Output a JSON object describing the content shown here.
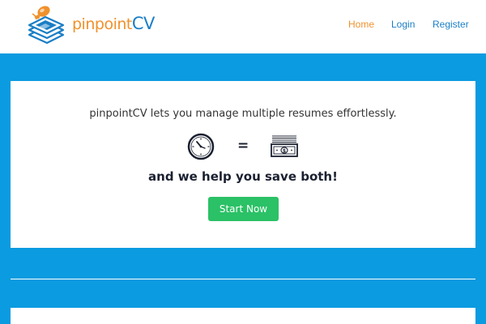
{
  "brand": {
    "name_part1": "pinpoint",
    "name_part2": "CV"
  },
  "nav": {
    "items": [
      {
        "label": "Home",
        "active": true
      },
      {
        "label": "Login",
        "active": false
      },
      {
        "label": "Register",
        "active": false
      }
    ]
  },
  "hero": {
    "tagline": "pinpointCV lets you manage multiple resumes effortlessly.",
    "equation_symbol": "=",
    "subline": "and we help you save both!",
    "cta_label": "Start Now"
  },
  "icons": {
    "clock": "clock-icon",
    "money": "money-icon",
    "logo": "pinned-documents-logo-icon"
  },
  "colors": {
    "background": "#0b9be0",
    "brand_orange": "#f0912c",
    "brand_blue": "#1a7ec5",
    "cta_green": "#2bc166",
    "heading_dark": "#1b2030"
  }
}
